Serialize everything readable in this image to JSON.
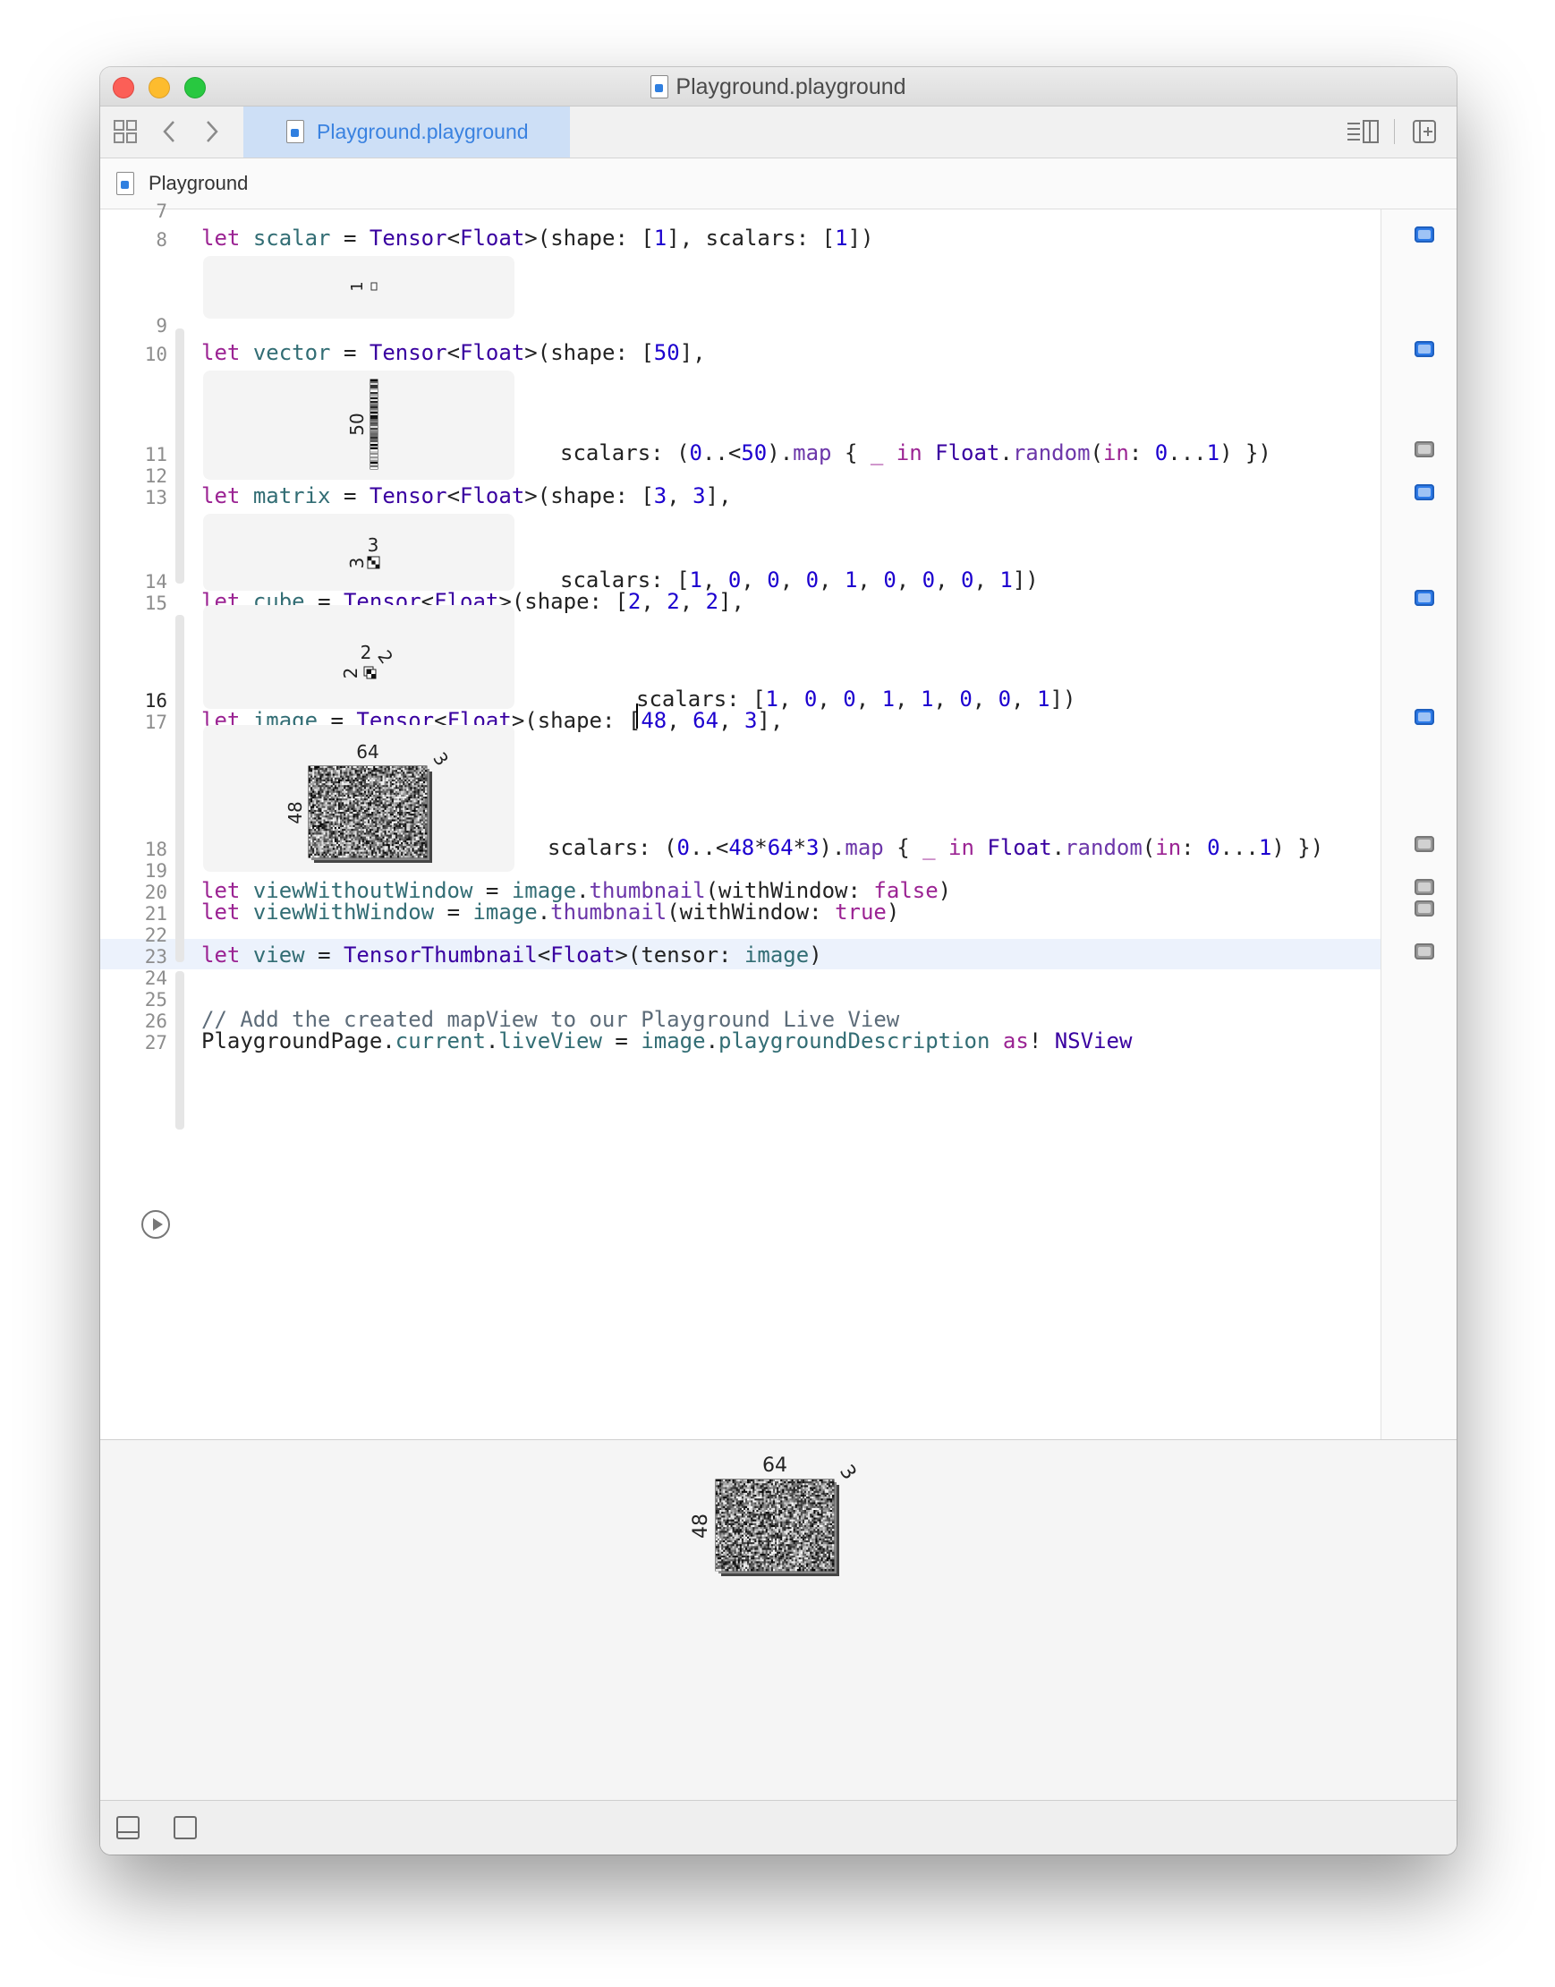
{
  "window": {
    "title": "Playground.playground",
    "tab_label": "Playground.playground",
    "jumpbar_label": "Playground"
  },
  "icons": {
    "grid": "grid-icon",
    "back": "chevron-left-icon",
    "forward": "chevron-right-icon",
    "editor_toggle": "editor-layout-icon",
    "add_editor": "add-editor-icon",
    "play": "play-icon",
    "hide_debug": "debug-area-icon",
    "square": "square-icon"
  },
  "colors": {
    "keyword": "#9b2393",
    "type": "#3900a0",
    "number": "#1c00cf",
    "identifier": "#326d74",
    "function": "#6c36a9",
    "comment": "#5d6c79",
    "accent": "#2c7ae8"
  },
  "editor": {
    "lines": [
      {
        "num": "7",
        "code": ""
      },
      {
        "num": "8",
        "code": "let scalar = Tensor<Float>(shape: [1], scalars: [1])"
      },
      {
        "num": "9",
        "code": ""
      },
      {
        "num": "10",
        "code": "let vector = Tensor<Float>(shape: [50],"
      },
      {
        "num": "11",
        "code": "scalars: (0..<50).map { _ in Float.random(in: 0...1) })"
      },
      {
        "num": "12",
        "code": ""
      },
      {
        "num": "13",
        "code": "let matrix = Tensor<Float>(shape: [3, 3],"
      },
      {
        "num": "14",
        "code": "scalars: [1, 0, 0, 0, 1, 0, 0, 0, 1])"
      },
      {
        "num": "15",
        "code": "let cube = Tensor<Float>(shape: [2, 2, 2],"
      },
      {
        "num": "16",
        "code": "scalars: [1, 0, 0, 1, 1, 0, 0, 1])"
      },
      {
        "num": "17",
        "code": "let image = Tensor<Float>(shape: [48, 64, 3],"
      },
      {
        "num": "18",
        "code": "scalars: (0..<48*64*3).map { _ in Float.random(in: 0...1) })"
      },
      {
        "num": "19",
        "code": ""
      },
      {
        "num": "20",
        "code": "let viewWithoutWindow = image.thumbnail(withWindow: false)"
      },
      {
        "num": "21",
        "code": "let viewWithWindow = image.thumbnail(withWindow: true)"
      },
      {
        "num": "22",
        "code": ""
      },
      {
        "num": "23",
        "code": "let view = TensorThumbnail<Float>(tensor: image)"
      },
      {
        "num": "24",
        "code": ""
      },
      {
        "num": "25",
        "code": ""
      },
      {
        "num": "26",
        "code": "// Add the created mapView to our Playground Live View"
      },
      {
        "num": "27",
        "code": "PlaygroundPage.current.liveView = image.playgroundDescription as! NSView"
      }
    ],
    "current_line": "16"
  },
  "results": {
    "scalar": {
      "dim0": "1"
    },
    "vector": {
      "dim0": "50"
    },
    "matrix": {
      "rows": "3",
      "cols": "3"
    },
    "cube": {
      "d0": "2",
      "d1": "2",
      "d2": "2"
    },
    "image": {
      "height": "48",
      "width": "64",
      "channels": "3"
    }
  },
  "live_view": {
    "height": "48",
    "width": "64",
    "channels": "3"
  }
}
